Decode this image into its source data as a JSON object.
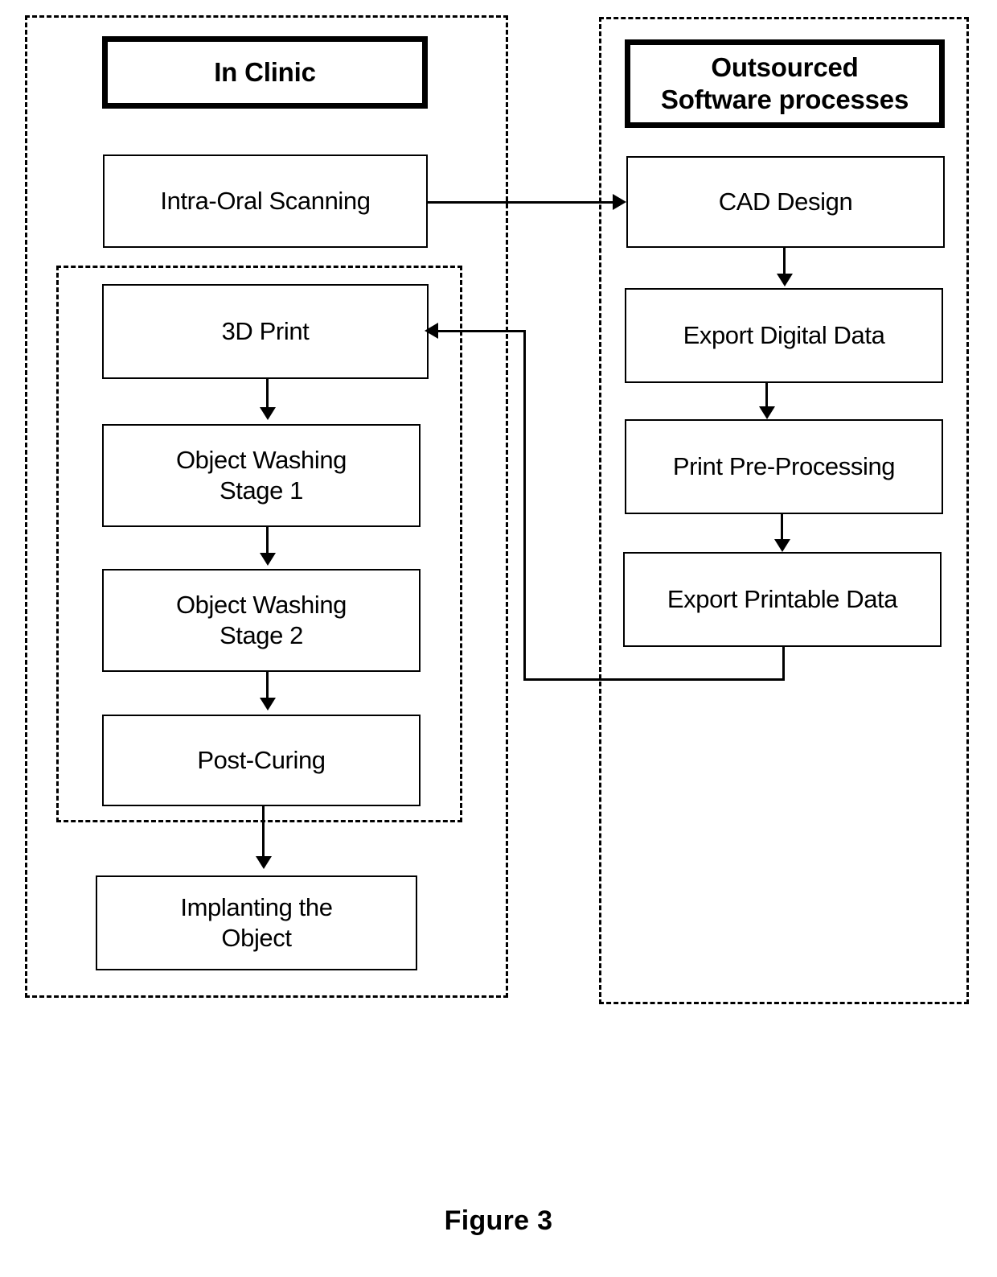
{
  "figure": {
    "caption": "Figure 3"
  },
  "lanes": [
    {
      "id": "in-clinic",
      "header": "In Clinic",
      "inner_group_label": ""
    },
    {
      "id": "outsourced",
      "header": "Outsourced\nSoftware processes",
      "header_line1": "Outsourced",
      "header_line2": "Software processes"
    }
  ],
  "nodes": {
    "in_clinic": [
      {
        "id": "intra-oral-scanning",
        "label": "Intra-Oral Scanning"
      },
      {
        "id": "3d-print",
        "label": "3D Print"
      },
      {
        "id": "object-washing-stage-1",
        "label_line1": "Object Washing",
        "label_line2": "Stage 1"
      },
      {
        "id": "object-washing-stage-2",
        "label_line1": "Object Washing",
        "label_line2": "Stage 2"
      },
      {
        "id": "post-curing",
        "label": "Post-Curing"
      },
      {
        "id": "implanting-the-object",
        "label_line1": "Implanting the",
        "label_line2": "Object"
      }
    ],
    "outsourced": [
      {
        "id": "cad-design",
        "label": "CAD Design"
      },
      {
        "id": "export-digital-data",
        "label": "Export Digital Data"
      },
      {
        "id": "print-pre-processing",
        "label": "Print Pre-Processing"
      },
      {
        "id": "export-printable-data",
        "label": "Export Printable Data"
      }
    ]
  },
  "flow": {
    "edges": [
      {
        "from": "intra-oral-scanning",
        "to": "cad-design",
        "direction": "right"
      },
      {
        "from": "cad-design",
        "to": "export-digital-data",
        "direction": "down"
      },
      {
        "from": "export-digital-data",
        "to": "print-pre-processing",
        "direction": "down"
      },
      {
        "from": "print-pre-processing",
        "to": "export-printable-data",
        "direction": "down"
      },
      {
        "from": "export-printable-data",
        "to": "3d-print",
        "direction": "left-feedback"
      },
      {
        "from": "3d-print",
        "to": "object-washing-stage-1",
        "direction": "down"
      },
      {
        "from": "object-washing-stage-1",
        "to": "object-washing-stage-2",
        "direction": "down"
      },
      {
        "from": "object-washing-stage-2",
        "to": "post-curing",
        "direction": "down"
      },
      {
        "from": "post-curing",
        "to": "implanting-the-object",
        "direction": "down"
      }
    ]
  },
  "colors": {
    "stroke": "#000000",
    "background": "#ffffff"
  }
}
